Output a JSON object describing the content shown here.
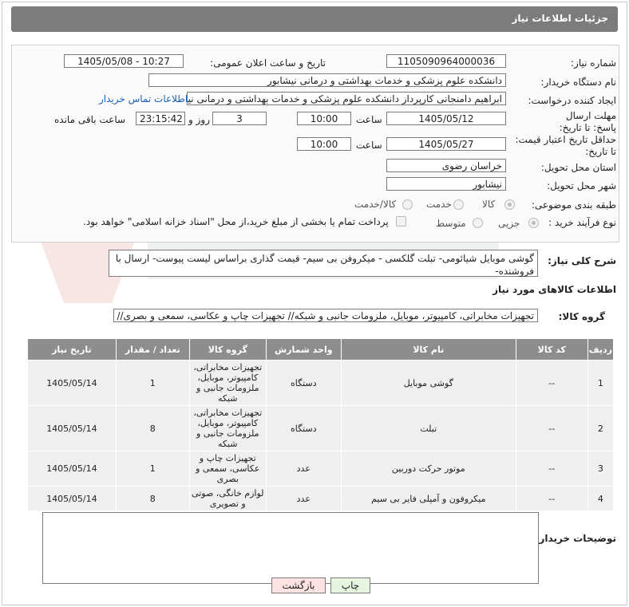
{
  "header": {
    "title": "جزئیات اطلاعات نیاز"
  },
  "fields": {
    "need_number_label": "شماره نیاز:",
    "need_number": "1105090964000036",
    "announce_label": "تاریخ و ساعت اعلان عمومی:",
    "announce_value": "1405/05/08 - 10:27",
    "buyer_org_label": "نام دستگاه خریدار:",
    "buyer_org": "دانشکده علوم پزشکی و خدمات بهداشتی و درمانی نیشابور",
    "creator_label": "ایجاد کننده درخواست:",
    "creator": "ابراهیم دامنجانی  کارپرداز دانشکده علوم پزشکی و خدمات بهداشتی و درمانی نیشابور",
    "contact_link": "اطلاعات تماس خریدار",
    "reply_deadline_label": "مهلت ارسال پاسخ: تا تاریخ:",
    "reply_date": "1405/05/12",
    "time_label": "ساعت",
    "reply_time": "10:00",
    "days_value": "3",
    "days_label": "روز و",
    "remaining_time": "23:15:42",
    "remaining_label": "ساعت باقی مانده",
    "price_deadline_label": "حداقل تاریخ اعتبار قیمت: تا تاریخ:",
    "price_date": "1405/05/27",
    "price_time": "10:00",
    "province_label": "استان محل تحویل:",
    "province": "خراسان رضوی",
    "city_label": "شهر محل تحویل:",
    "city": "نیشابور",
    "category_label": "طبقه بندی موضوعی:",
    "category_options": [
      "کالا",
      "خدمت",
      "کالا/خدمت"
    ],
    "process_label": "نوع فرآیند خرید :",
    "process_options": [
      "جزیی",
      "متوسط"
    ],
    "payment_note": "پرداخت تمام یا بخشی از مبلغ خرید،از محل \"اسناد خزانه اسلامی\" خواهد بود."
  },
  "summary": {
    "label": "شرح کلی نیاز:",
    "text": "گوشی موبایل شیائومی- تبلت گلکسی - میکروفن بی سیم- قیمت گذاری براساس لیست پیوست- ارسال با فروشنده-"
  },
  "goods": {
    "section_title": "اطلاعات کالاهای مورد نیاز",
    "group_label": "گروه کالا:",
    "group_value": "تجهیزات مخابراتی، کامپیوتر، موبایل، ملزومات جانبی و شبکه// تجهیزات چاپ و عکاسی، سمعی و بصری// لوازم",
    "columns": [
      "ردیف",
      "کد کالا",
      "نام کالا",
      "واحد شمارش",
      "گروه کالا",
      "تعداد / مقدار",
      "تاریخ نیاز"
    ],
    "rows": [
      {
        "row": "1",
        "code": "--",
        "name": "گوشی موبایل",
        "unit": "دستگاه",
        "group": "تجهیزات مخابراتی، کامپیوتر، موبایل، ملزومات جانبی و شبکه",
        "qty": "1",
        "date": "1405/05/14"
      },
      {
        "row": "2",
        "code": "--",
        "name": "تبلت",
        "unit": "دستگاه",
        "group": "تجهیزات مخابراتی، کامپیوتر، موبایل، ملزومات جانبی و شبکه",
        "qty": "8",
        "date": "1405/05/14"
      },
      {
        "row": "3",
        "code": "--",
        "name": "موتور حرکت دوربین",
        "unit": "عدد",
        "group": "تجهیزات چاپ و عکاسی، سمعی و بصری",
        "qty": "1",
        "date": "1405/05/14"
      },
      {
        "row": "4",
        "code": "--",
        "name": "میکروفون و آمپلی فایر بی سیم",
        "unit": "عدد",
        "group": "لوازم خانگی، صوتی و تصویری",
        "qty": "8",
        "date": "1405/05/14"
      }
    ]
  },
  "notes": {
    "label": "توضیحات خریدار:"
  },
  "buttons": {
    "print": "چاپ",
    "back": "بازگشت"
  },
  "colors": {
    "titlebar": "#7c7c7c",
    "table_header": "#8d8d8d",
    "link": "#1b5fb4",
    "back_button": "#ffe3e3",
    "print_button": "#e5f5e0"
  }
}
